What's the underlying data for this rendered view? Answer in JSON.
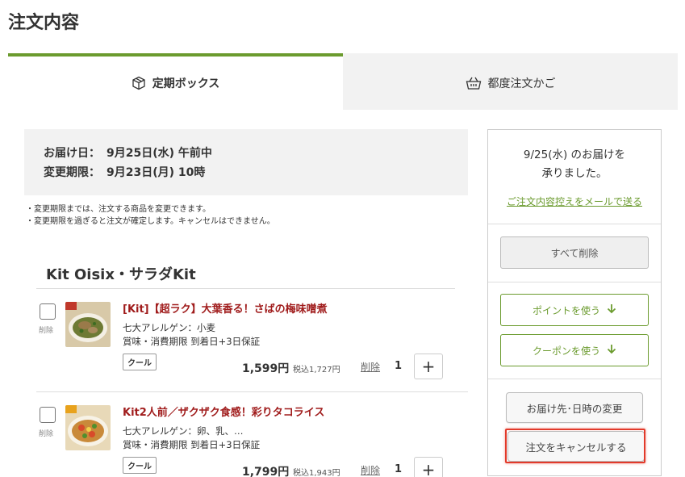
{
  "page": {
    "title": "注文内容"
  },
  "tabs": [
    {
      "label": "定期ボックス",
      "icon": "box-icon",
      "active": true
    },
    {
      "label": "都度注文かご",
      "icon": "basket-icon",
      "active": false
    }
  ],
  "delivery": {
    "date_label": "お届け日：",
    "date_value": "9月25日(水) 午前中",
    "deadline_label": "変更期限：",
    "deadline_value": "9月23日(月) 10時"
  },
  "notes": [
    "・変更期限までは、注文する商品を変更できます。",
    "・変更期限を過ぎると注文が確定します。キャンセルはできません。"
  ],
  "section": {
    "title": "Kit Oisix・サラダKit"
  },
  "items": [
    {
      "name": "[Kit]【超ラク】大葉香る！さばの梅味噌煮",
      "allergen": "七大アレルゲン：小麦",
      "expiry": "賞味・消費期限 到着日+3日保証",
      "tag": "クール",
      "price": "1,599円",
      "price_tax": "税込1,727円",
      "delete_label": "削除",
      "qty": "1",
      "plus": "+",
      "checkbox_label": "削除"
    },
    {
      "name": "Kit2人前／ザクザク食感！彩りタコライス",
      "allergen": "七大アレルゲン：卵、乳、…",
      "expiry": "賞味・消費期限 到着日+3日保証",
      "tag": "クール",
      "price": "1,799円",
      "price_tax": "税込1,943円",
      "delete_label": "削除",
      "qty": "1",
      "plus": "+",
      "checkbox_label": "削除"
    }
  ],
  "side": {
    "message_line1": "9/25(水) のお届けを",
    "message_line2": "承りました。",
    "email_link": "ご注文内容控えをメールで送る",
    "delete_all": "すべて削除",
    "use_points": "ポイントを使う",
    "use_coupon": "クーポンを使う",
    "change_delivery": "お届け先･日時の変更",
    "cancel_order": "注文をキャンセルする"
  },
  "colors": {
    "accent": "#6b9b2e",
    "item_name": "#a01c1c",
    "highlight": "#e23a2a"
  }
}
